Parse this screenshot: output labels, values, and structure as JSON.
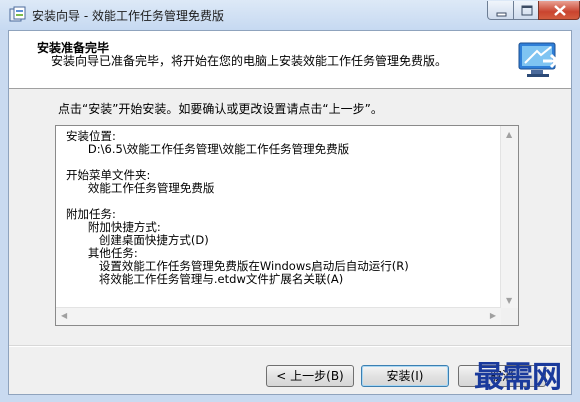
{
  "window": {
    "title": "安装向导 - 效能工作任务管理免费版"
  },
  "header": {
    "title": "安装准备完毕",
    "description": "安装向导已准备完毕，将开始在您的电脑上安装效能工作任务管理免费版。"
  },
  "instruction": "点击“安装”开始安装。如要确认或更改设置请点击“上一步”。",
  "summary": {
    "text": "安装位置:\n      D:\\6.5\\效能工作任务管理\\效能工作任务管理免费版\n\n开始菜单文件夹:\n      效能工作任务管理免费版\n\n附加任务:\n      附加快捷方式:\n         创建桌面快捷方式(D)\n      其他任务:\n         设置效能工作任务管理免费版在Windows启动后自动运行(R)\n         将效能工作任务管理与.etdw文件扩展名关联(A)"
  },
  "buttons": {
    "back": "< 上一步(B)",
    "install": "安装(I)",
    "cancel": "取消"
  },
  "watermark": "最需网"
}
